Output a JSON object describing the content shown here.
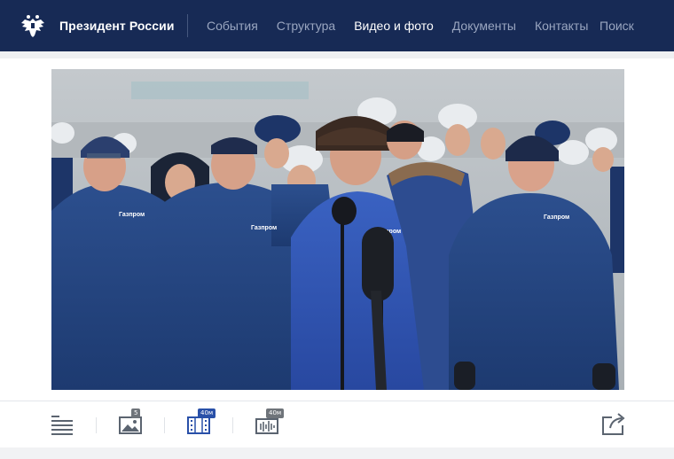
{
  "header": {
    "site_title": "Президент России",
    "nav": [
      {
        "label": "События",
        "active": false
      },
      {
        "label": "Структура",
        "active": false
      },
      {
        "label": "Видео и фото",
        "active": true
      },
      {
        "label": "Документы",
        "active": false
      },
      {
        "label": "Контакты",
        "active": false
      }
    ],
    "search_label": "Поиск",
    "emblem_icon": "double-headed-eagle-icon"
  },
  "photo": {
    "jacket_logo_text": "Газпром"
  },
  "toolbar": {
    "text_icon": "text-lines-icon",
    "photos_icon": "photo-gallery-icon",
    "photos_badge": "5",
    "video_icon": "video-film-icon",
    "video_badge": "40м",
    "audio_icon": "audio-wave-icon",
    "audio_badge": "40м",
    "share_icon": "share-icon"
  },
  "colors": {
    "header_bg": "#172a55",
    "nav_inactive": "#9aa6c0",
    "nav_active": "#ffffff",
    "toolbar_icon": "#5b6470",
    "video_badge_bg": "#2950a8",
    "gray_badge_bg": "#6f747a"
  }
}
